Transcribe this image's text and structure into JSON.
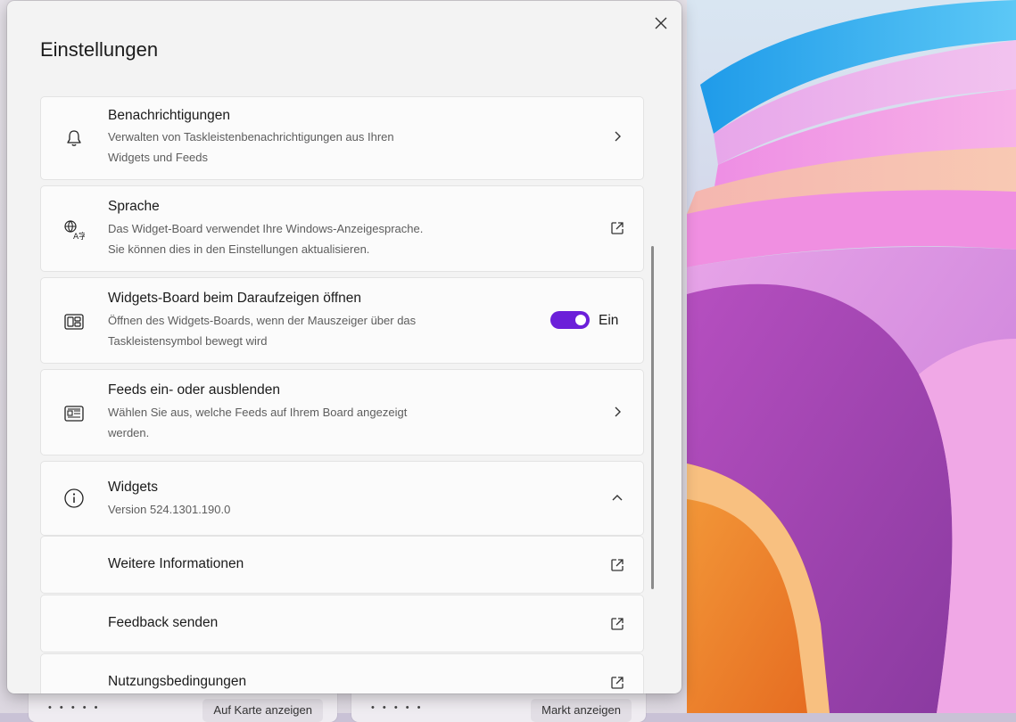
{
  "dialog": {
    "title": "Einstellungen",
    "close_icon": "close-icon"
  },
  "settings": [
    {
      "id": "notifications",
      "icon": "bell-icon",
      "title": "Benachrichtigungen",
      "description_line1": "Verwalten von Taskleistenbenachrichtigungen aus Ihren",
      "description_line2": "Widgets und Feeds",
      "trailing": "chevron-right-icon"
    },
    {
      "id": "language",
      "icon": "language-icon",
      "title": "Sprache",
      "description_line1": "Das Widget-Board verwendet Ihre Windows-Anzeigesprache.",
      "description_line2": "Sie können dies in den Einstellungen aktualisieren.",
      "trailing": "external-link-icon"
    },
    {
      "id": "open-on-hover",
      "icon": "widgets-board-icon",
      "title": "Widgets-Board beim Daraufzeigen öffnen",
      "description_line1": "Öffnen des Widgets-Boards, wenn der Mauszeiger über das",
      "description_line2": "Taskleistensymbol bewegt wird",
      "toggle_state": "Ein",
      "toggle_on": true
    },
    {
      "id": "feeds",
      "icon": "news-feed-icon",
      "title": "Feeds ein- oder ausblenden",
      "description_line1": "Wählen Sie aus, welche Feeds auf Ihrem Board angezeigt",
      "description_line2": "werden.",
      "trailing": "chevron-right-icon"
    },
    {
      "id": "widgets-info",
      "icon": "info-icon",
      "title": "Widgets",
      "description_line1": "Version 524.1301.190.0",
      "trailing": "chevron-up-icon"
    }
  ],
  "widgets_subitems": [
    {
      "label": "Weitere Informationen",
      "trailing": "external-link-icon"
    },
    {
      "label": "Feedback senden",
      "trailing": "external-link-icon"
    },
    {
      "label": "Nutzungsbedingungen",
      "trailing": "external-link-icon"
    }
  ],
  "background": {
    "left_card_button": "Auf Karte anzeigen",
    "right_card_button": "Markt anzeigen",
    "dots": "• • • • •"
  },
  "colors": {
    "accent": "#6b1fd9",
    "dialog_bg": "#f3f3f3",
    "card_bg": "#fbfbfb"
  }
}
